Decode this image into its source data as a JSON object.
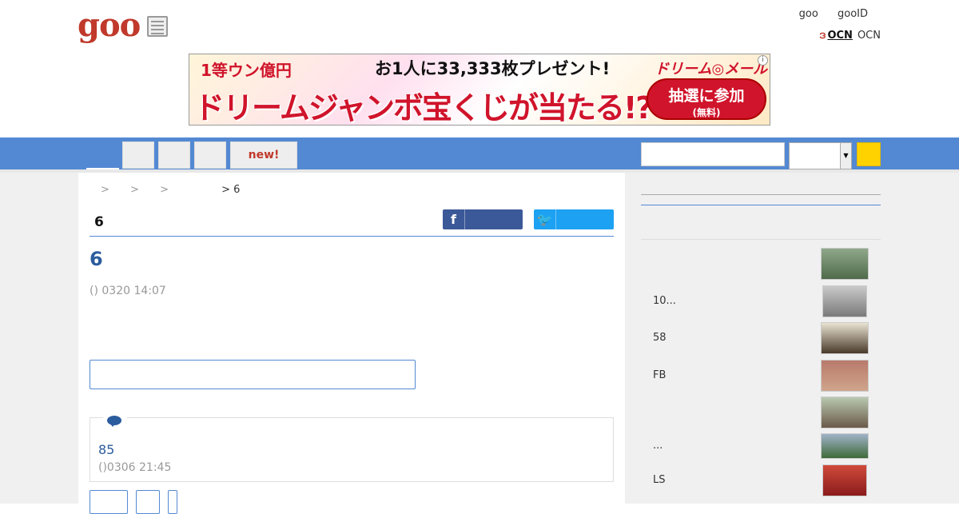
{
  "header": {
    "logo": "goo",
    "links": [
      "goo",
      "gooID"
    ],
    "ocn_mark": "ဒ",
    "ocn_logo": "OCN",
    "ocn_label": "OCN"
  },
  "banner": {
    "line1_left": "1等ウン億円",
    "line1_right": "お1人に33,333枚プレゼント!",
    "line2": "ドリームジャンボ宝くじが当たる!?",
    "brand": "ドリーム◎メール",
    "cta_main": "抽選に参加",
    "cta_sub": "(無料)",
    "info": "i"
  },
  "nav": {
    "tabs": [
      "",
      "",
      "",
      "new!"
    ]
  },
  "breadcrumb": [
    ">",
    ">",
    ">",
    "> 6"
  ],
  "section_title": "6",
  "share": {
    "fb_icon": "f",
    "tw_icon": "🐦"
  },
  "article": {
    "title": "6",
    "meta": "() 0320 14:07"
  },
  "comments": {
    "count": "85",
    "meta": "()0306 21:45"
  },
  "sidebar": {
    "items": [
      {
        "label": ""
      },
      {
        "label": "10..."
      },
      {
        "label": "58"
      },
      {
        "label": "FB"
      },
      {
        "label": ""
      },
      {
        "label": "..."
      },
      {
        "label": "LS"
      }
    ]
  },
  "colors": {
    "nav": "#5389d3",
    "accent": "#2b5c9e",
    "logo": "#c0392b",
    "search_button": "#ffd200"
  }
}
